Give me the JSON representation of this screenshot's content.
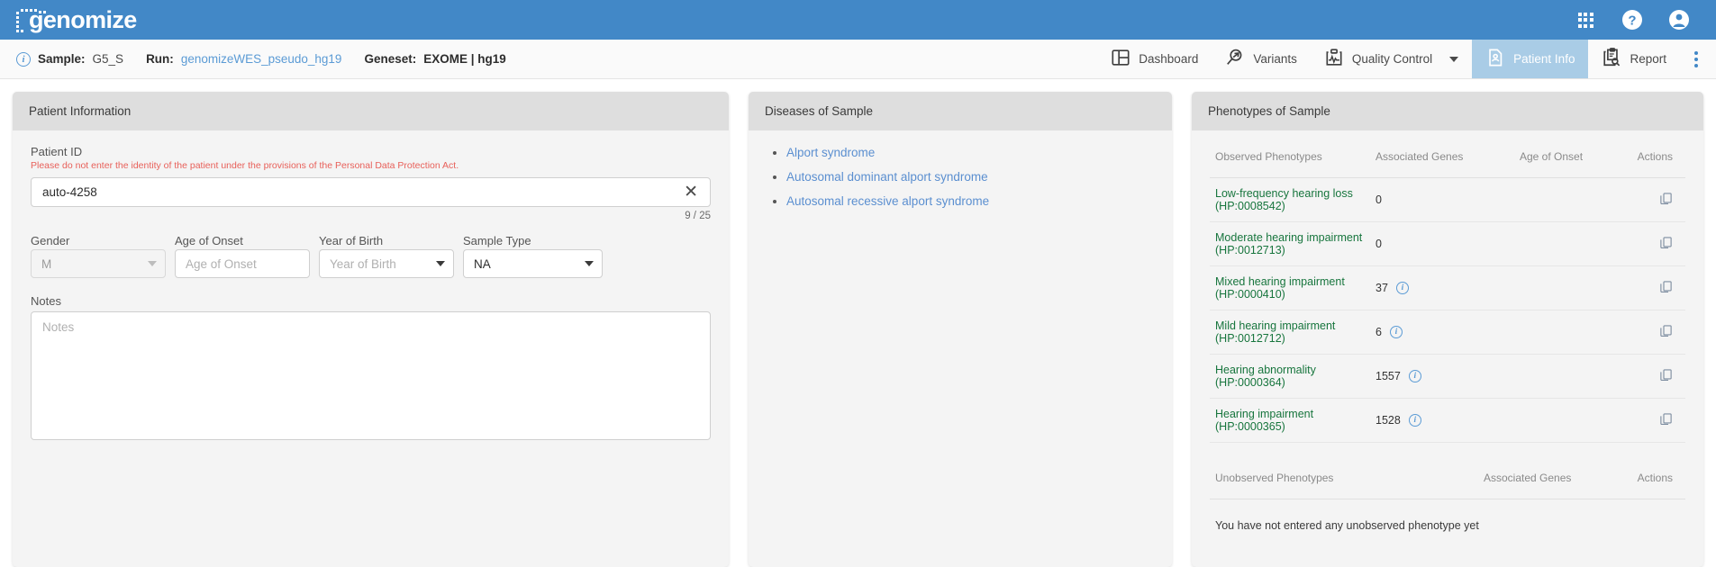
{
  "brand": {
    "name": "genomize",
    "bar_color": "#4288c7"
  },
  "topbar_icons": [
    {
      "name": "apps-grid-icon",
      "label": "Apps"
    },
    {
      "name": "help-icon",
      "label": "Help"
    },
    {
      "name": "account-icon",
      "label": "Account"
    }
  ],
  "breadcrumb": {
    "info_glyph": "i",
    "sample_label": "Sample:",
    "sample_value": "G5_S",
    "run_label": "Run:",
    "run_value": "genomizeWES_pseudo_hg19",
    "geneset_label": "Geneset:",
    "geneset_value": "EXOME | hg19"
  },
  "nav": {
    "tabs": [
      {
        "label": "Dashboard",
        "icon": "dashboard-icon",
        "active": false,
        "caret": false
      },
      {
        "label": "Variants",
        "icon": "variants-search-icon",
        "active": false,
        "caret": false
      },
      {
        "label": "Quality Control",
        "icon": "quality-control-icon",
        "active": false,
        "caret": true
      },
      {
        "label": "Patient Info",
        "icon": "patient-info-icon",
        "active": true,
        "caret": false
      },
      {
        "label": "Report",
        "icon": "report-icon",
        "active": false,
        "caret": false
      }
    ],
    "overflow_label": "More options",
    "active_tab_color": "#a9cce6"
  },
  "patient_panel": {
    "title": "Patient Information",
    "patient_id_label": "Patient ID",
    "warning": "Please do not enter the identity of the patient under the provisions of the Personal Data Protection Act.",
    "patient_id_value": "auto-4258",
    "clear_glyph": "✕",
    "char_counter": "9 / 25",
    "fields": [
      {
        "label": "Gender",
        "value": "M",
        "placeholder": "",
        "disabled": true,
        "has_arrow": true
      },
      {
        "label": "Age of Onset",
        "value": "",
        "placeholder": "Age of Onset",
        "disabled": false,
        "has_arrow": false
      },
      {
        "label": "Year of Birth",
        "value": "",
        "placeholder": "Year of Birth",
        "disabled": false,
        "has_arrow": true
      },
      {
        "label": "Sample Type",
        "value": "NA",
        "placeholder": "",
        "disabled": false,
        "has_arrow": true
      }
    ],
    "notes_label": "Notes",
    "notes_placeholder": "Notes",
    "notes_value": ""
  },
  "diseases_panel": {
    "title": "Diseases of Sample",
    "items": [
      "Alport syndrome",
      "Autosomal dominant alport syndrome",
      "Autosomal recessive alport syndrome"
    ]
  },
  "phenotypes_panel": {
    "title": "Phenotypes of Sample",
    "observed_headers": [
      "Observed Phenotypes",
      "Associated Genes",
      "Age of Onset",
      "Actions"
    ],
    "observed_rows": [
      {
        "name": "Low-frequency hearing loss (HP:0008542)",
        "genes": "0",
        "has_info": false,
        "age_of_onset": "",
        "action": "copy-icon"
      },
      {
        "name": "Moderate hearing impairment (HP:0012713)",
        "genes": "0",
        "has_info": false,
        "age_of_onset": "",
        "action": "copy-icon"
      },
      {
        "name": "Mixed hearing impairment (HP:0000410)",
        "genes": "37",
        "has_info": true,
        "age_of_onset": "",
        "action": "copy-icon"
      },
      {
        "name": "Mild hearing impairment (HP:0012712)",
        "genes": "6",
        "has_info": true,
        "age_of_onset": "",
        "action": "copy-icon"
      },
      {
        "name": "Hearing abnormality (HP:0000364)",
        "genes": "1557",
        "has_info": true,
        "age_of_onset": "",
        "action": "copy-icon"
      },
      {
        "name": "Hearing impairment (HP:0000365)",
        "genes": "1528",
        "has_info": true,
        "age_of_onset": "",
        "action": "copy-icon"
      }
    ],
    "unobserved_headers": [
      "Unobserved Phenotypes",
      "Associated Genes",
      "Actions"
    ],
    "unobserved_empty_message": "You have not entered any unobserved phenotype yet",
    "phenotype_link_color": "#17753d",
    "info_glyph": "i"
  }
}
